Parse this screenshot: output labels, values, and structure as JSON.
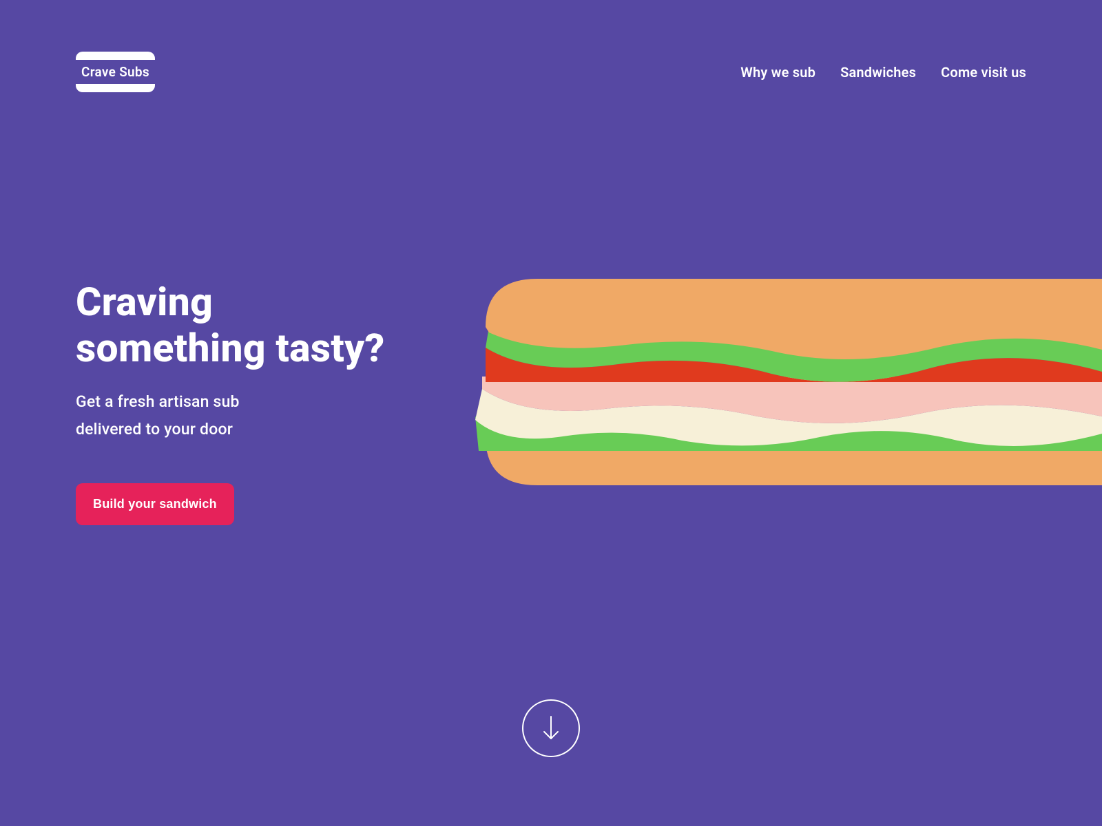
{
  "brand": {
    "name": "Crave Subs"
  },
  "nav": {
    "items": [
      {
        "label": "Why we sub"
      },
      {
        "label": "Sandwiches"
      },
      {
        "label": "Come visit us"
      }
    ]
  },
  "hero": {
    "title_line1": "Craving",
    "title_line2": "something tasty?",
    "subtitle_line1": "Get a fresh artisan sub",
    "subtitle_line2": "delivered to your door",
    "cta_label": "Build your sandwich"
  },
  "colors": {
    "background": "#5648a3",
    "accent": "#e6225a",
    "bread": "#f0a966",
    "lettuce": "#68cc56",
    "tomato": "#e03a1e",
    "ham": "#f7c4bb",
    "cheese": "#f7f0d8"
  }
}
